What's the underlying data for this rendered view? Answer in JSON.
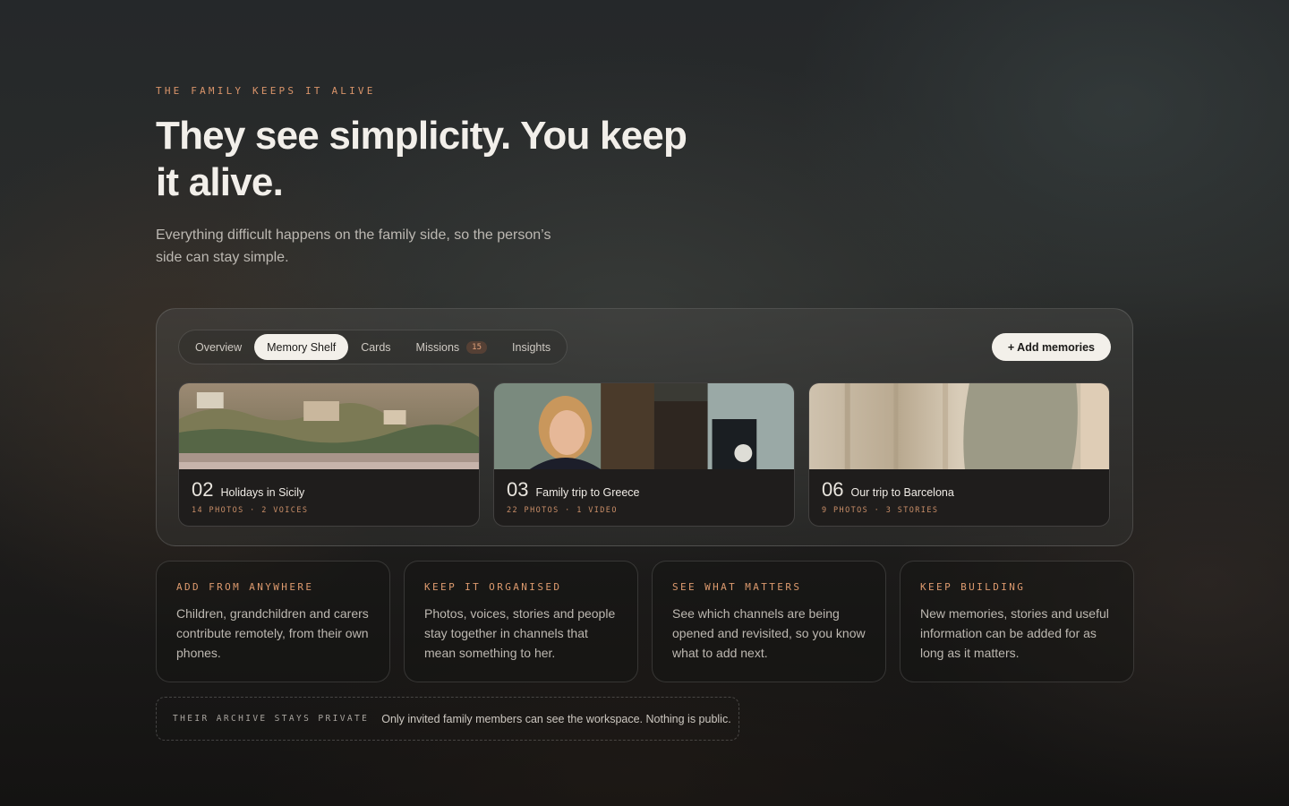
{
  "hero": {
    "eyebrow": "THE FAMILY KEEPS IT ALIVE",
    "headline": "They see simplicity. You keep it alive.",
    "subhead": "Everything difficult happens on the family side, so the person’s side can stay simple."
  },
  "workspace": {
    "tabs": [
      {
        "label": "Overview"
      },
      {
        "label": "Memory Shelf",
        "active": true
      },
      {
        "label": "Cards"
      },
      {
        "label": "Missions",
        "count": "15"
      },
      {
        "label": "Insights"
      }
    ],
    "add_button": "+ Add memories",
    "memories": [
      {
        "number": "02",
        "title": "Holidays in Sicily",
        "meta": "14 PHOTOS · 2 VOICES"
      },
      {
        "number": "03",
        "title": "Family trip to Greece",
        "meta": "22 PHOTOS · 1 VIDEO"
      },
      {
        "number": "06",
        "title": "Our trip to Barcelona",
        "meta": "9 PHOTOS · 3 STORIES"
      }
    ]
  },
  "features": [
    {
      "label": "ADD FROM ANYWHERE",
      "text": "Children, grandchildren and carers contribute remotely, from their own phones."
    },
    {
      "label": "KEEP IT ORGANISED",
      "text": "Photos, voices, stories and people stay together in channels that mean something to her."
    },
    {
      "label": "SEE WHAT MATTERS",
      "text": "See which channels are being opened and revisited, so you know what to add next."
    },
    {
      "label": "KEEP BUILDING",
      "text": "New memories, stories and useful information can be added for as long as it matters."
    }
  ],
  "privacy": {
    "label": "THEIR ARCHIVE STAYS PRIVATE",
    "text": "Only invited family members can see the workspace. Nothing is public."
  }
}
